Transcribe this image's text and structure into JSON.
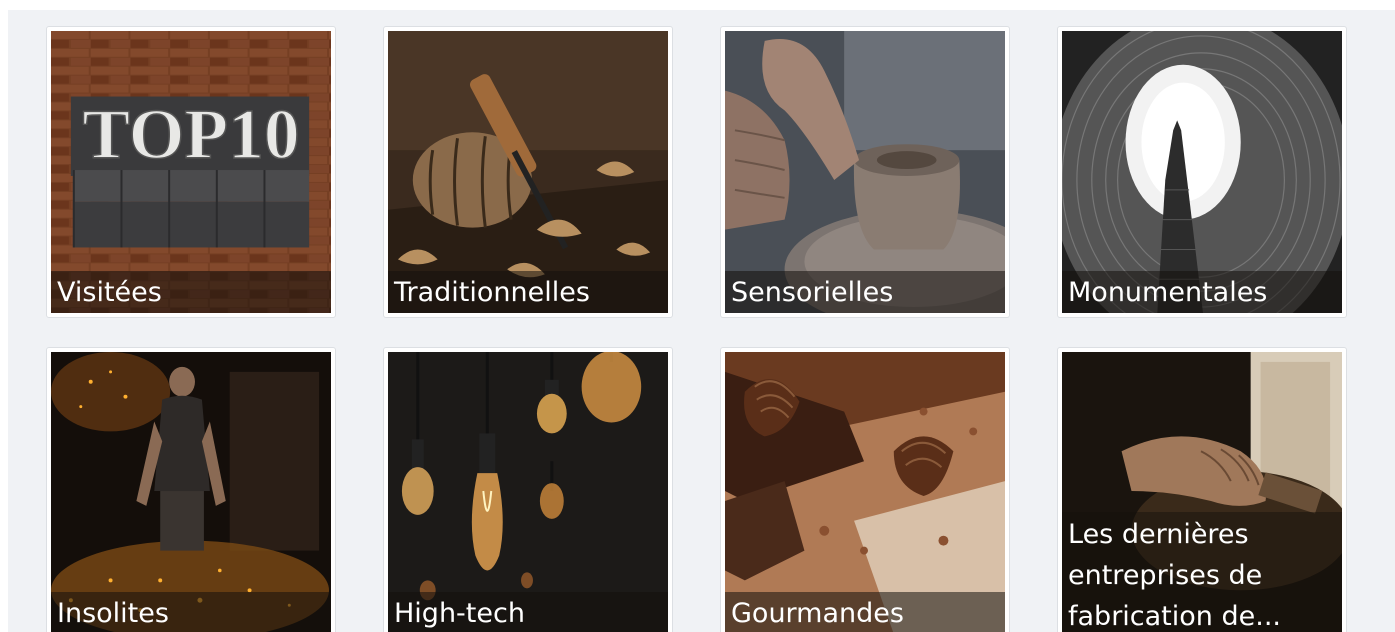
{
  "cards": [
    {
      "label": "Visitées",
      "icon": "top10-letterpress-photo"
    },
    {
      "label": "Traditionnelles",
      "icon": "woodworking-tools-photo"
    },
    {
      "label": "Sensorielles",
      "icon": "pottery-wheel-photo"
    },
    {
      "label": "Monumentales",
      "icon": "tower-structure-photo"
    },
    {
      "label": "Insolites",
      "icon": "blacksmith-sparks-photo"
    },
    {
      "label": "High-tech",
      "icon": "edison-bulbs-photo"
    },
    {
      "label": "Gourmandes",
      "icon": "chocolate-photo"
    },
    {
      "label": "Les dernières entreprises de fabrication de...",
      "icon": "craftsman-hands-photo"
    }
  ],
  "top10_text": "TOP10"
}
